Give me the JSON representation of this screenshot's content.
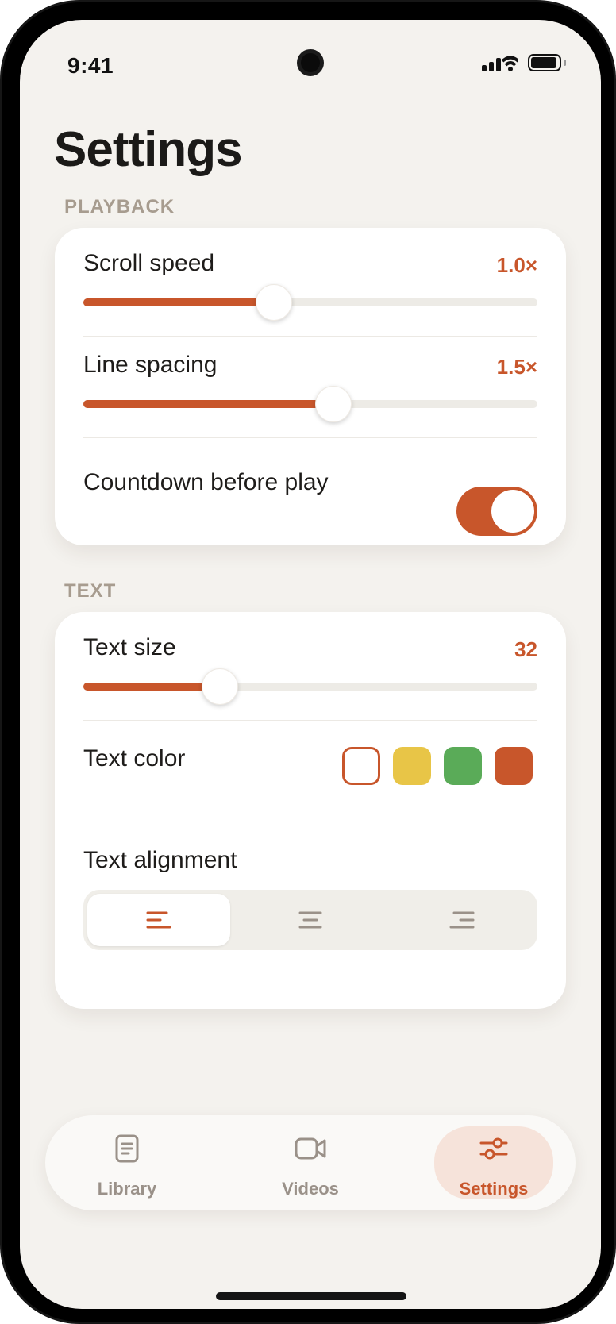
{
  "status_bar": {
    "time": "9:41"
  },
  "page_title": "Settings",
  "colors": {
    "accent": "#c8562b",
    "label": "#a79c8f",
    "background": "#f4f2ee"
  },
  "playback": {
    "section_label": "PLAYBACK",
    "scroll_speed": {
      "label": "Scroll speed",
      "value": "1.0×",
      "fraction": 0.42
    },
    "line_spacing": {
      "label": "Line spacing",
      "value": "1.5×",
      "fraction": 0.55
    },
    "countdown": {
      "label": "Countdown before play",
      "enabled": true
    }
  },
  "text": {
    "section_label": "TEXT",
    "text_size": {
      "label": "Text size",
      "value": "32",
      "fraction": 0.3
    },
    "text_color": {
      "label": "Text color",
      "swatches": [
        {
          "name": "white",
          "color": "#ffffff",
          "selected": true
        },
        {
          "name": "yellow",
          "color": "#e8c547",
          "selected": false
        },
        {
          "name": "green",
          "color": "#5aab58",
          "selected": false
        },
        {
          "name": "orange",
          "color": "#c8562b",
          "selected": false
        }
      ]
    },
    "text_alignment": {
      "label": "Text alignment",
      "options": [
        "align-left-icon",
        "align-center-icon",
        "align-right-icon"
      ],
      "selected": 0
    }
  },
  "tabbar": {
    "items": [
      {
        "label": "Library",
        "icon": "document-icon",
        "active": false
      },
      {
        "label": "Videos",
        "icon": "video-camera-icon",
        "active": false
      },
      {
        "label": "Settings",
        "icon": "sliders-icon",
        "active": true
      }
    ]
  }
}
